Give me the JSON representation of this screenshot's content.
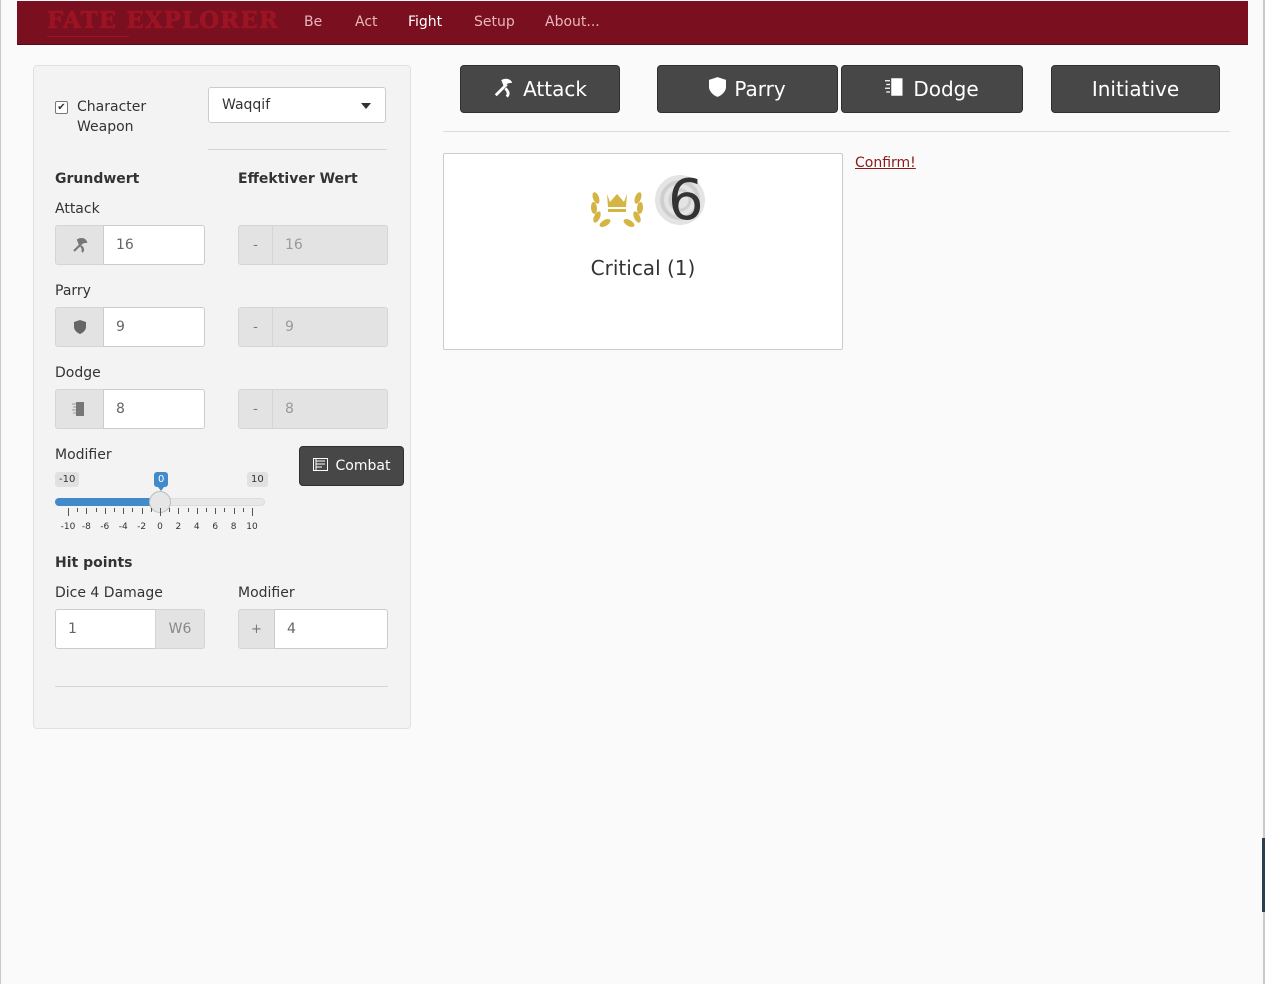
{
  "navbar": {
    "brand": "FATE EXPLORER",
    "items": [
      {
        "label": "Be"
      },
      {
        "label": "Act"
      },
      {
        "label": "Fight",
        "active": true
      },
      {
        "label": "Setup"
      },
      {
        "label": "About..."
      }
    ],
    "color": "#7a0f1f"
  },
  "sidebar": {
    "character_weapon_checked": true,
    "character_weapon_label_line1": "Character",
    "character_weapon_label_line2": "Weapon",
    "weapon_select_value": "Waqqif",
    "col_base": "Grundwert",
    "col_effective": "Effektiver Wert",
    "attack": {
      "label": "Attack",
      "base": "16",
      "eff_sign": "-",
      "effective": "16",
      "icon": "axe-icon"
    },
    "parry": {
      "label": "Parry",
      "base": "9",
      "eff_sign": "-",
      "effective": "9",
      "icon": "shield-icon"
    },
    "dodge": {
      "label": "Dodge",
      "base": "8",
      "eff_sign": "-",
      "effective": "8",
      "icon": "dodge-icon"
    },
    "modifier": {
      "label": "Modifier",
      "min_label": "-10",
      "max_label": "10",
      "current_label": "0",
      "min": -10,
      "max": 10,
      "value": 0,
      "tick_labels": [
        "-10",
        "-8",
        "-6",
        "-4",
        "-2",
        "0",
        "2",
        "4",
        "6",
        "8",
        "10"
      ]
    },
    "combat_button": "Combat",
    "hit_points": {
      "title": "Hit points",
      "dice_label": "Dice 4 Damage",
      "dice_value": "1",
      "dice_unit": "W6",
      "mod_label": "Modifier",
      "mod_sign": "+",
      "mod_value": "4"
    }
  },
  "actions": {
    "attack": "Attack",
    "parry": "Parry",
    "dodge": "Dodge",
    "initiative": "Initiative"
  },
  "result": {
    "die_value": "6",
    "text": "Critical (1)",
    "confirm_link": "Confirm!",
    "laurel_color": "#d4b443"
  }
}
